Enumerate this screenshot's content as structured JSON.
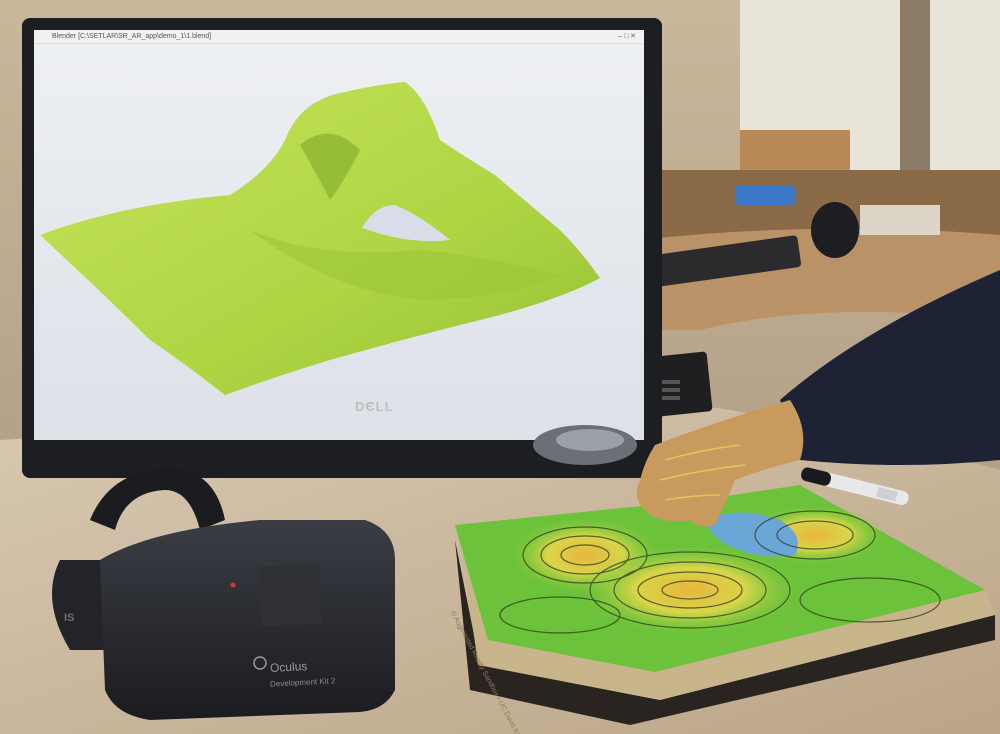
{
  "window": {
    "title": "Blender [C:\\SETLAR\\SR_AR_app\\demo_1\\1.blend]",
    "controls": "–  □  ✕"
  },
  "monitor": {
    "brand": "DЄLL"
  },
  "headset": {
    "brand": "Oculus",
    "model": "Development Kit 2",
    "side_mark": "IS"
  },
  "sandbox": {
    "caption": "© Augmented Reality Sandbox • UC Davis KeckCAVES"
  },
  "colors": {
    "terrain": "#b5d94a",
    "screen_bg": "#e7eaef",
    "sand_green": "#6fc63d",
    "sand_yellow": "#d8d54a",
    "water": "#6aa6d6"
  }
}
